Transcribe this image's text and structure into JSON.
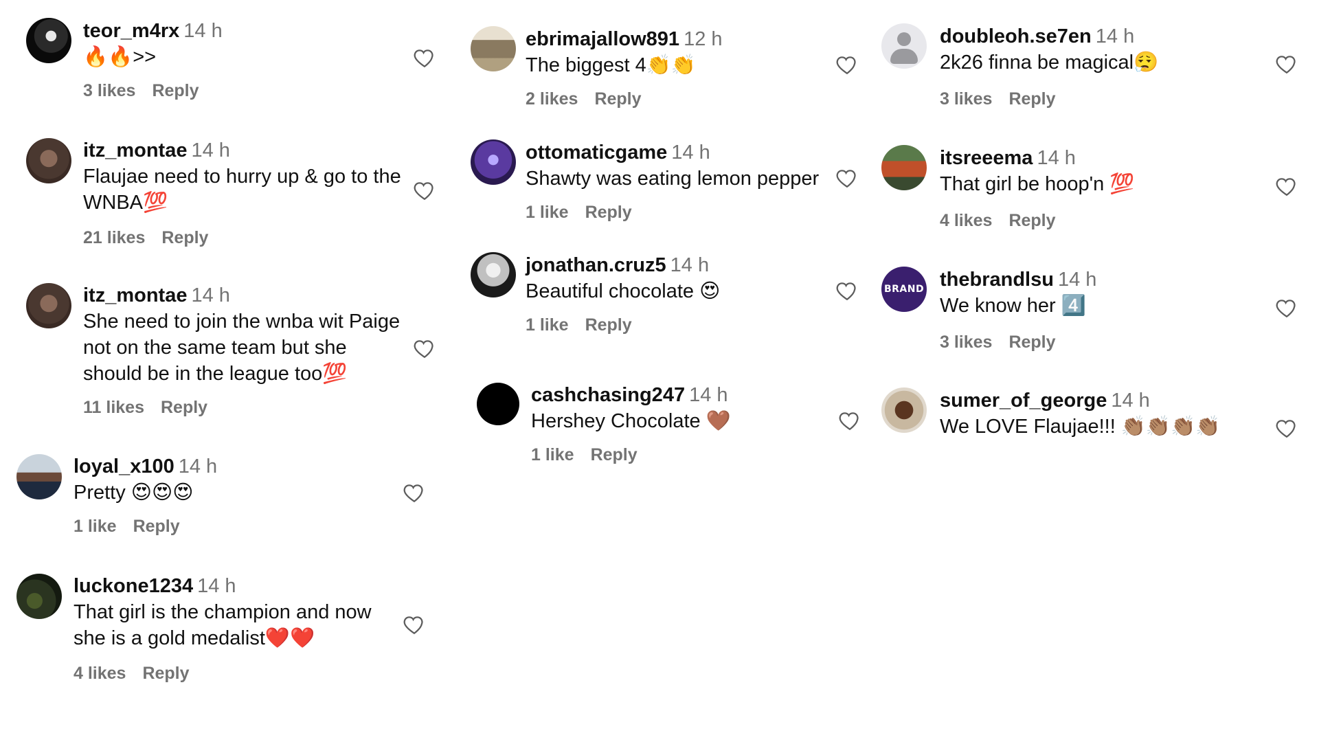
{
  "colors": {
    "username": "#111111",
    "meta": "#737373",
    "heart_outline": "#5c5c5c"
  },
  "comments": [
    {
      "username": "teor_m4rx",
      "time": "14 h",
      "text": "🔥🔥>>",
      "likes": "3 likes",
      "reply": "Reply",
      "avatar": "dark-character-avatar"
    },
    {
      "username": "itz_montae",
      "time": "14 h",
      "text": "Flaujae need to hurry up & go to the WNBA💯",
      "likes": "21 likes",
      "reply": "Reply",
      "avatar": "person-photo-avatar"
    },
    {
      "username": "itz_montae",
      "time": "14 h",
      "text": "She need to join the wnba wit Paige not on the same team but she should be in the league too💯",
      "likes": "11 likes",
      "reply": "Reply",
      "avatar": "person-photo-avatar"
    },
    {
      "username": "loyal_x100",
      "time": "14 h",
      "text": "Pretty 😍😍😍",
      "likes": "1 like",
      "reply": "Reply",
      "avatar": "man-in-suit-avatar"
    },
    {
      "username": "luckone1234",
      "time": "14 h",
      "text": "That girl is the champion and now she is a gold medalist❤️❤️",
      "likes": "4 likes",
      "reply": "Reply",
      "avatar": "dark-landscape-avatar"
    },
    {
      "username": "ebrimajallow891",
      "time": "12 h",
      "text": "The biggest 4👏👏",
      "likes": "2 likes",
      "reply": "Reply",
      "avatar": "person-standing-avatar"
    },
    {
      "username": "ottomaticgame",
      "time": "14 h",
      "text": "Shawty was eating lemon pepper",
      "likes": "1 like",
      "reply": "Reply",
      "avatar": "purple-character-avatar"
    },
    {
      "username": "jonathan.cruz5",
      "time": "14 h",
      "text": "Beautiful chocolate 😍",
      "likes": "1 like",
      "reply": "Reply",
      "avatar": "hooded-figure-avatar"
    },
    {
      "username": "cashchasing247",
      "time": "14 h",
      "text": "Hershey Chocolate 🤎",
      "likes": "1 like",
      "reply": "Reply",
      "avatar": "black-circle-avatar"
    },
    {
      "username": "doubleoh.se7en",
      "time": "14 h",
      "text": "2k26 finna be magical😮‍💨",
      "likes": "3 likes",
      "reply": "Reply",
      "avatar": "default-profile-avatar"
    },
    {
      "username": "itsreeema",
      "time": "14 h",
      "text": "That girl be hoop'n 💯",
      "likes": "4 likes",
      "reply": "Reply",
      "avatar": "outdoor-person-avatar"
    },
    {
      "username": "thebrandlsu",
      "time": "14 h",
      "text": "We know her 4️⃣",
      "likes": "3 likes",
      "reply": "Reply",
      "avatar": "brand-logo-avatar",
      "avatar_text": "BRAND"
    },
    {
      "username": "sumer_of_george",
      "time": "14 h",
      "text": "We LOVE Flaujae!!! 👏🏽👏🏽👏🏽👏🏽",
      "likes": "",
      "reply": "",
      "avatar": "raised-fist-avatar"
    }
  ]
}
